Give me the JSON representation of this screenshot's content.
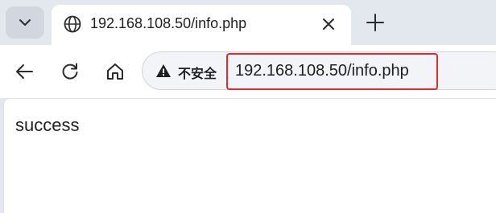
{
  "tab": {
    "title": "192.168.108.50/info.php",
    "icon": "globe-icon"
  },
  "address_bar": {
    "security_label": "不安全",
    "security_icon": "warning-icon",
    "url": "192.168.108.50/info.php"
  },
  "page": {
    "body_text": "success"
  },
  "colors": {
    "tabbar_bg": "#e3e7ee",
    "highlight_border": "#e02b2b",
    "text": "#1f1f1f"
  }
}
